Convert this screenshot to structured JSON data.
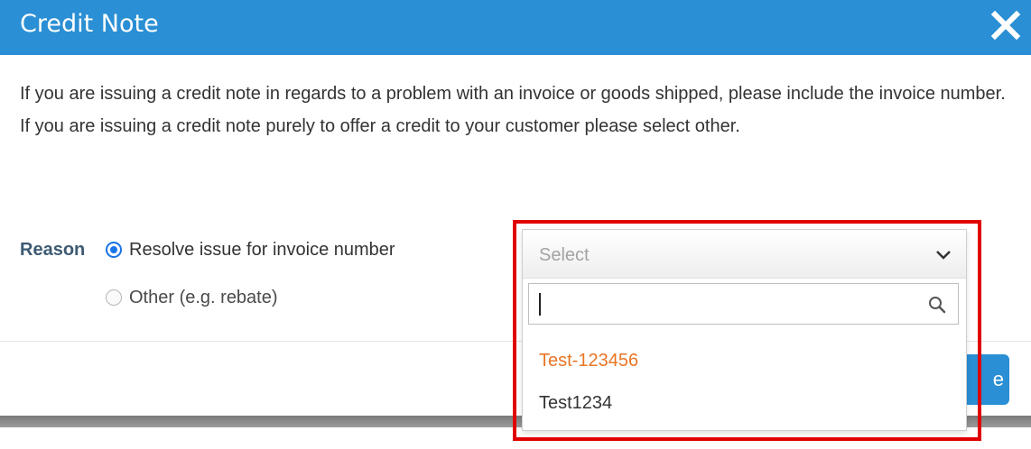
{
  "dialog": {
    "title": "Credit Note",
    "close_icon": "close-icon",
    "header_color": "#2a8fd4",
    "message": "If you are issuing a credit note in regards to a problem with an invoice or goods shipped, please include the invoice number. If you are issuing a credit note purely to offer a credit to your customer please select other."
  },
  "reason": {
    "label": "Reason",
    "options": [
      {
        "label": "Resolve issue for invoice number",
        "selected": true
      },
      {
        "label": "Other (e.g. rebate)",
        "selected": false
      }
    ]
  },
  "invoice_select": {
    "placeholder": "Select",
    "search_value": "",
    "search_icon": "search-icon",
    "chevron_icon": "chevron-down-icon",
    "options": [
      {
        "label": "Test-123456",
        "highlighted": true
      },
      {
        "label": "Test1234",
        "highlighted": false
      }
    ]
  },
  "footer": {
    "button_label_fragment": "e"
  },
  "colors": {
    "accent": "#2a8fd4",
    "highlight_option": "#e87524",
    "annotation_box": "#e00000",
    "reason_label": "#3d5a73"
  }
}
